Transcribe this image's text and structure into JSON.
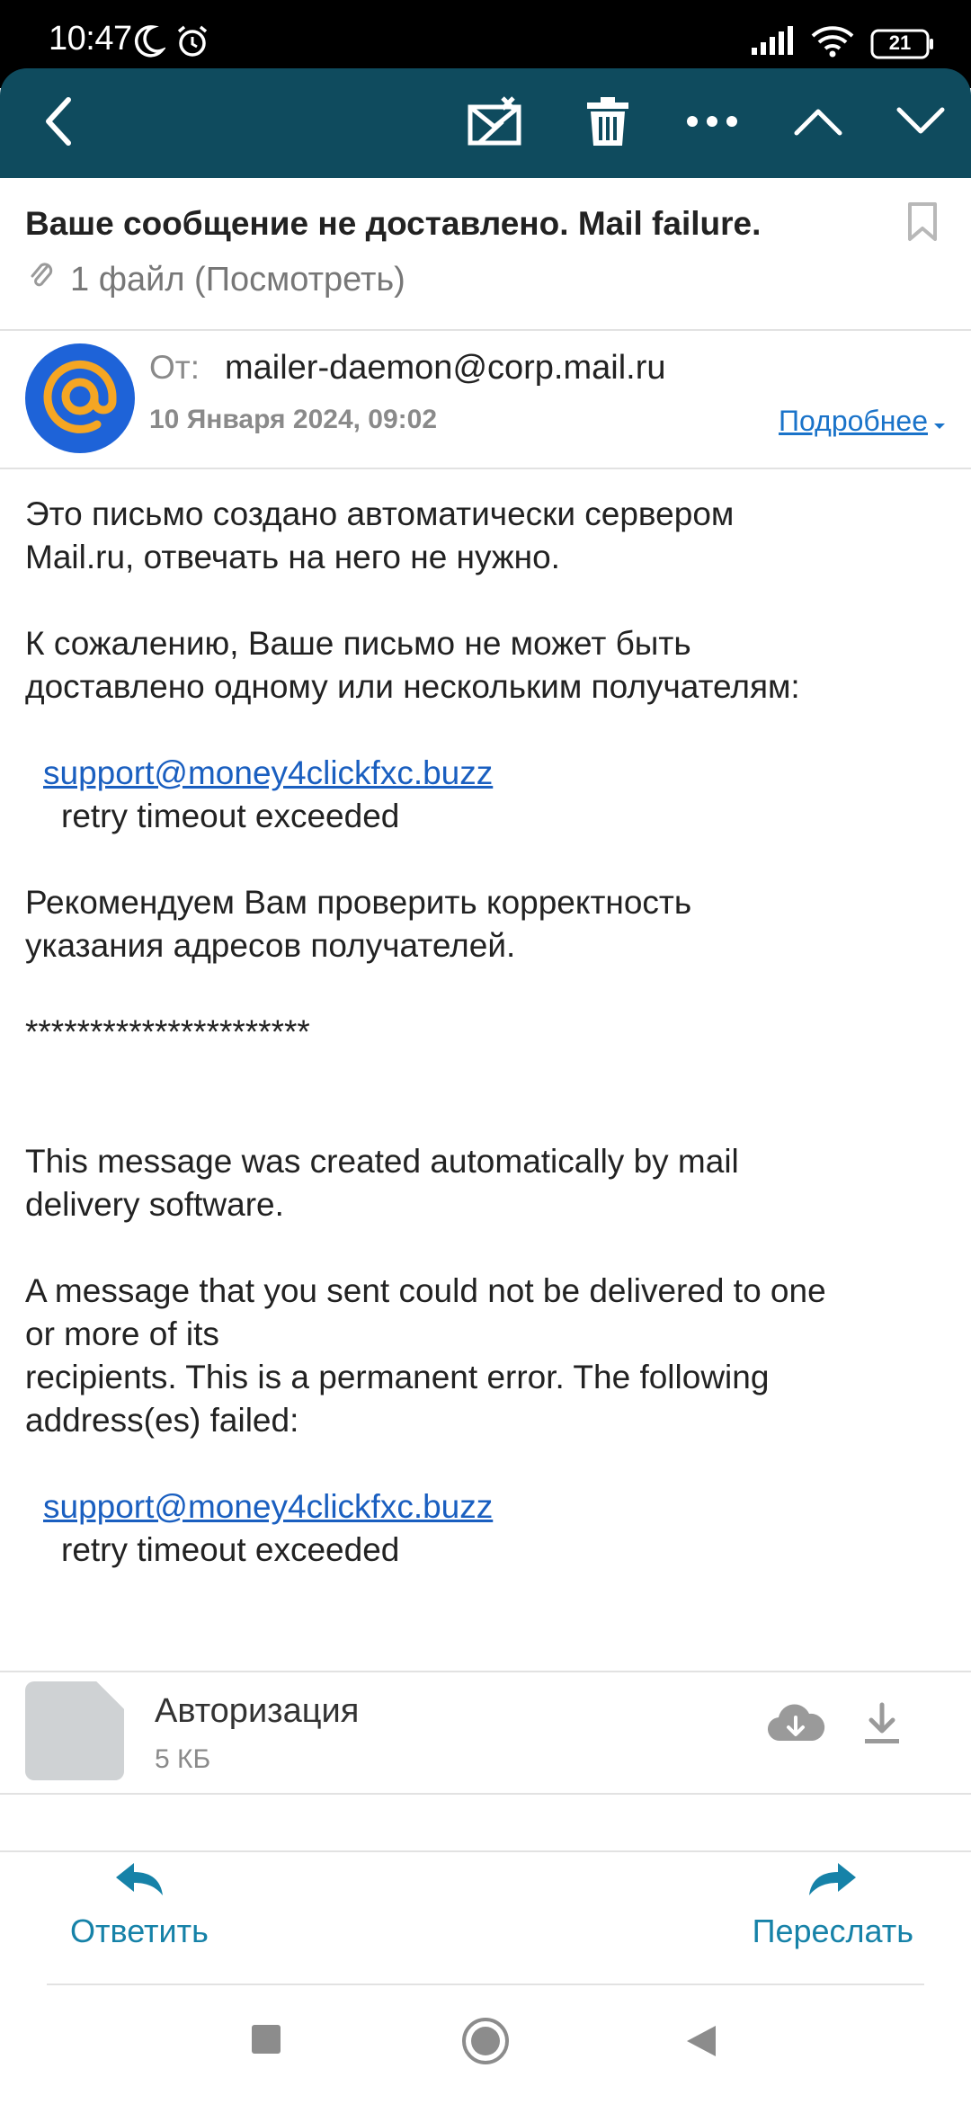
{
  "status_bar": {
    "time": "10:47",
    "battery": "21"
  },
  "toolbar": {
    "back_icon": "back-arrow-icon",
    "spam_icon": "mark-spam-icon",
    "delete_icon": "trash-icon",
    "more_icon": "more-icon",
    "prev_icon": "chevron-up-icon",
    "next_icon": "chevron-down-icon",
    "background_color": "#0f4b5e"
  },
  "message": {
    "subject": "Ваше сообщение не доставлено. Mail failure.",
    "attachments_summary": "1 файл (Посмотреть)",
    "from_label": "От:",
    "from_email": "mailer-daemon@corp.mail.ru",
    "date": "10 Января 2024, 09:02",
    "details_link": "Подробнее"
  },
  "body": {
    "ru_p1_l1": "Это письмо создано автоматически сервером",
    "ru_p1_l2": "Mail.ru, отвечать на него не нужно.",
    "ru_p2_l1": "К сожалению, Ваше письмо не может быть",
    "ru_p2_l2": "доставлено одному или нескольким получателям:",
    "ru_failed_address": "support@money4clickfxc.buzz",
    "ru_failed_reason": "retry timeout exceeded",
    "ru_p3_l1": "Рекомендуем Вам проверить корректность",
    "ru_p3_l2": "указания адресов получателей.",
    "separator": "**********************",
    "en_p1_l1": "This message was created automatically by mail",
    "en_p1_l2": "delivery software.",
    "en_p2_l1": "A message that you sent could not be delivered to one",
    "en_p2_l2": "or more of its",
    "en_p2_l3": "recipients. This is a permanent error. The following",
    "en_p2_l4": "address(es) failed:",
    "en_failed_address": "support@money4clickfxc.buzz",
    "en_failed_reason": "retry timeout exceeded"
  },
  "attachment": {
    "name": "Авторизация",
    "size": "5 КБ"
  },
  "actions": {
    "reply_label": "Ответить",
    "forward_label": "Переслать",
    "accent_color": "#1682a8"
  },
  "colors": {
    "link": "#1a5fc0",
    "avatar_bg": "#1e63d8",
    "avatar_fg": "#f5a623"
  }
}
